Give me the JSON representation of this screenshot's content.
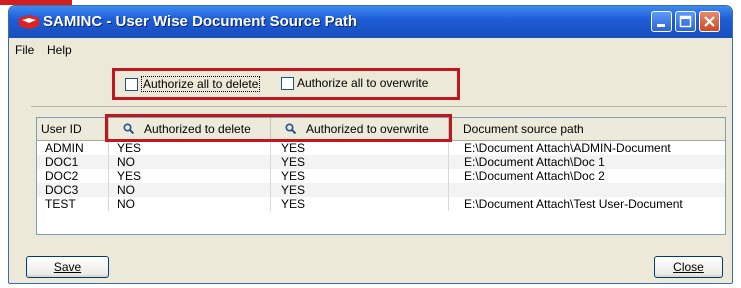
{
  "window": {
    "title": "SAMINC - User Wise Document Source Path"
  },
  "menu": {
    "file": "File",
    "help": "Help"
  },
  "options": {
    "authorize_delete": "Authorize all to delete",
    "authorize_overwrite": "Authorize all to overwrite"
  },
  "table": {
    "headers": {
      "user_id": "User ID",
      "auth_delete": "Authorized to delete",
      "auth_overwrite": "Authorized to overwrite",
      "path": "Document source path"
    },
    "rows": [
      {
        "user_id": "ADMIN",
        "delete": "YES",
        "overwrite": "YES",
        "path": "E:\\Document Attach\\ADMIN-Document"
      },
      {
        "user_id": "DOC1",
        "delete": "NO",
        "overwrite": "YES",
        "path": "E:\\Document Attach\\Doc 1"
      },
      {
        "user_id": "DOC2",
        "delete": "YES",
        "overwrite": "YES",
        "path": "E:\\Document Attach\\Doc 2"
      },
      {
        "user_id": "DOC3",
        "delete": "NO",
        "overwrite": "YES",
        "path": ""
      },
      {
        "user_id": "TEST",
        "delete": "NO",
        "overwrite": "YES",
        "path": "E:\\Document Attach\\Test User-Document"
      }
    ]
  },
  "buttons": {
    "save": "Save",
    "close": "Close"
  },
  "colors": {
    "highlight": "#c0161d",
    "titlebar": "#1f5ed8"
  }
}
